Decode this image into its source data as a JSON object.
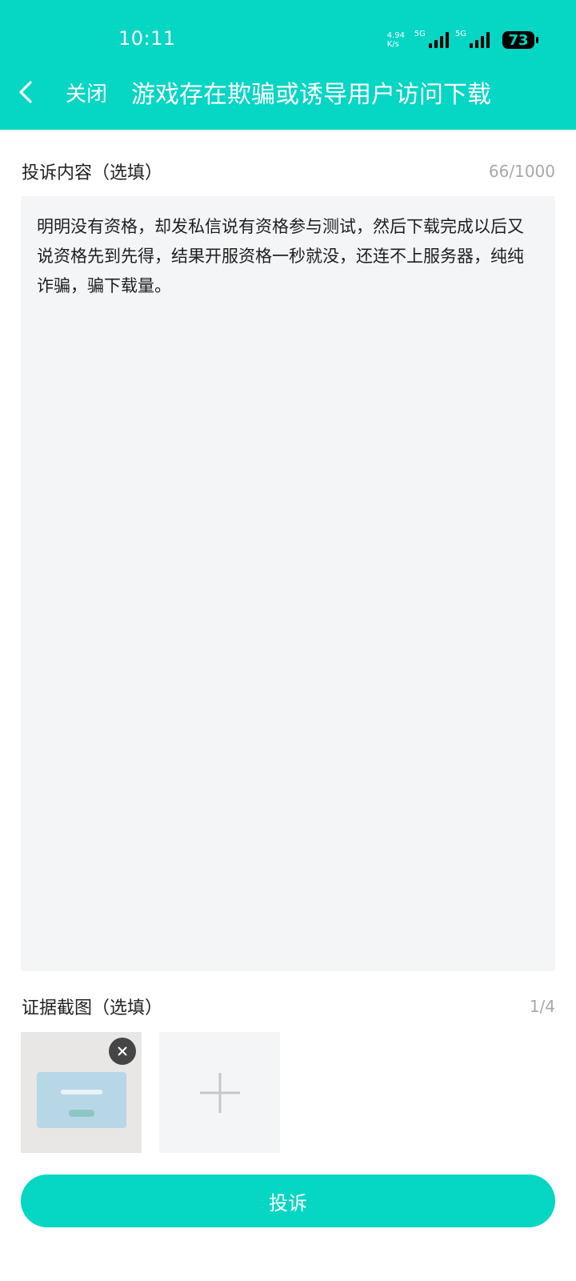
{
  "status_bar": {
    "time": "10:11",
    "speed": "4.94 K/s",
    "network_1": "5G",
    "network_2": "5G",
    "battery": "73"
  },
  "header": {
    "back_icon": "chevron-left-icon",
    "close_label": "关闭",
    "title": "游戏存在欺骗或诱导用户访问下载"
  },
  "complaint": {
    "label": "投诉内容（选填）",
    "counter": "66/1000",
    "text": "明明没有资格，却发私信说有资格参与测试，然后下载完成以后又说资格先到先得，结果开服资格一秒就没，还连不上服务器，纯纯诈骗，骗下载量。"
  },
  "evidence": {
    "label": "证据截图（选填）",
    "counter": "1/4",
    "add_icon": "plus-icon",
    "remove_icon": "close-icon"
  },
  "submit": {
    "label": "投诉"
  },
  "colors": {
    "accent": "#06D6C4",
    "field_bg": "#f4f5f7",
    "muted_text": "#a8a8a8"
  }
}
